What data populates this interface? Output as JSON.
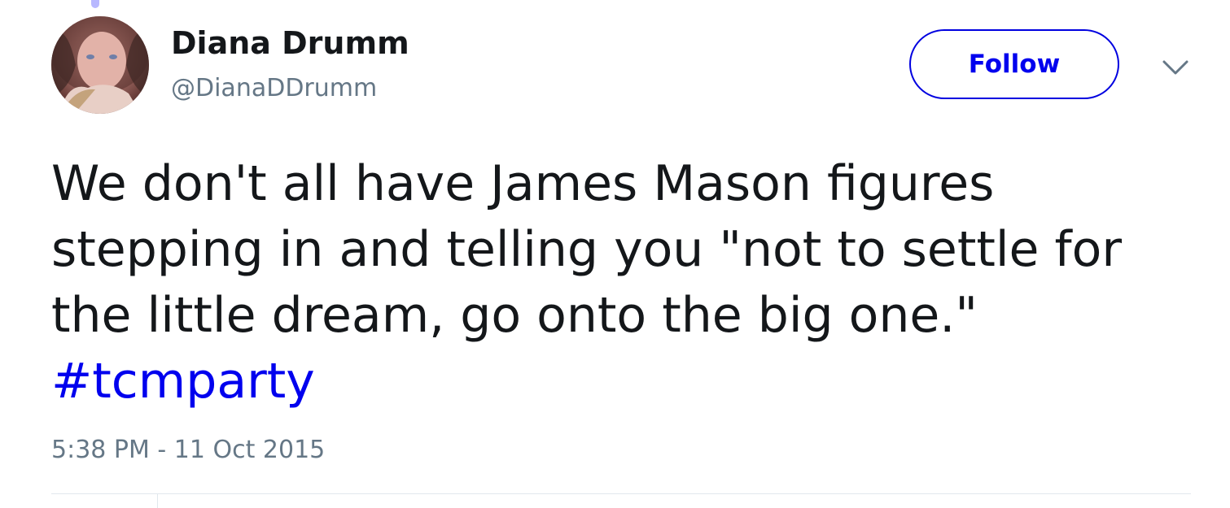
{
  "author": {
    "name": "Diana Drumm",
    "handle": "@DianaDDrumm"
  },
  "actions": {
    "follow_label": "Follow"
  },
  "tweet": {
    "lines": [
      "We don't all have James Mason figures",
      "stepping in and telling you \"not to settle for",
      "the little dream, go onto the big one.\""
    ],
    "hashtag": "#tcmparty",
    "timestamp": "5:38 PM - 11 Oct 2015"
  },
  "colors": {
    "link": "#0000ee",
    "text": "#14171a",
    "secondary": "#657786",
    "divider": "#e1e8ed"
  },
  "icons": {
    "menu": "chevron-down-icon"
  }
}
